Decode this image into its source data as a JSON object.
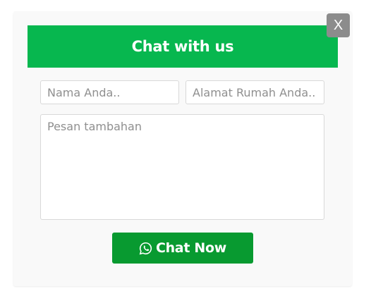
{
  "dialog": {
    "title": "Chat with us",
    "close_label": "X"
  },
  "form": {
    "name_placeholder": "Nama Anda..",
    "address_placeholder": "Alamat Rumah Anda..",
    "message_placeholder": "Pesan tambahan",
    "submit_label": "Chat Now",
    "submit_icon": "whatsapp-icon"
  },
  "colors": {
    "header_bg": "#07b74f",
    "button_bg": "#089a30",
    "close_bg": "#8c8c8c",
    "panel_bg": "#f9f9f9"
  }
}
